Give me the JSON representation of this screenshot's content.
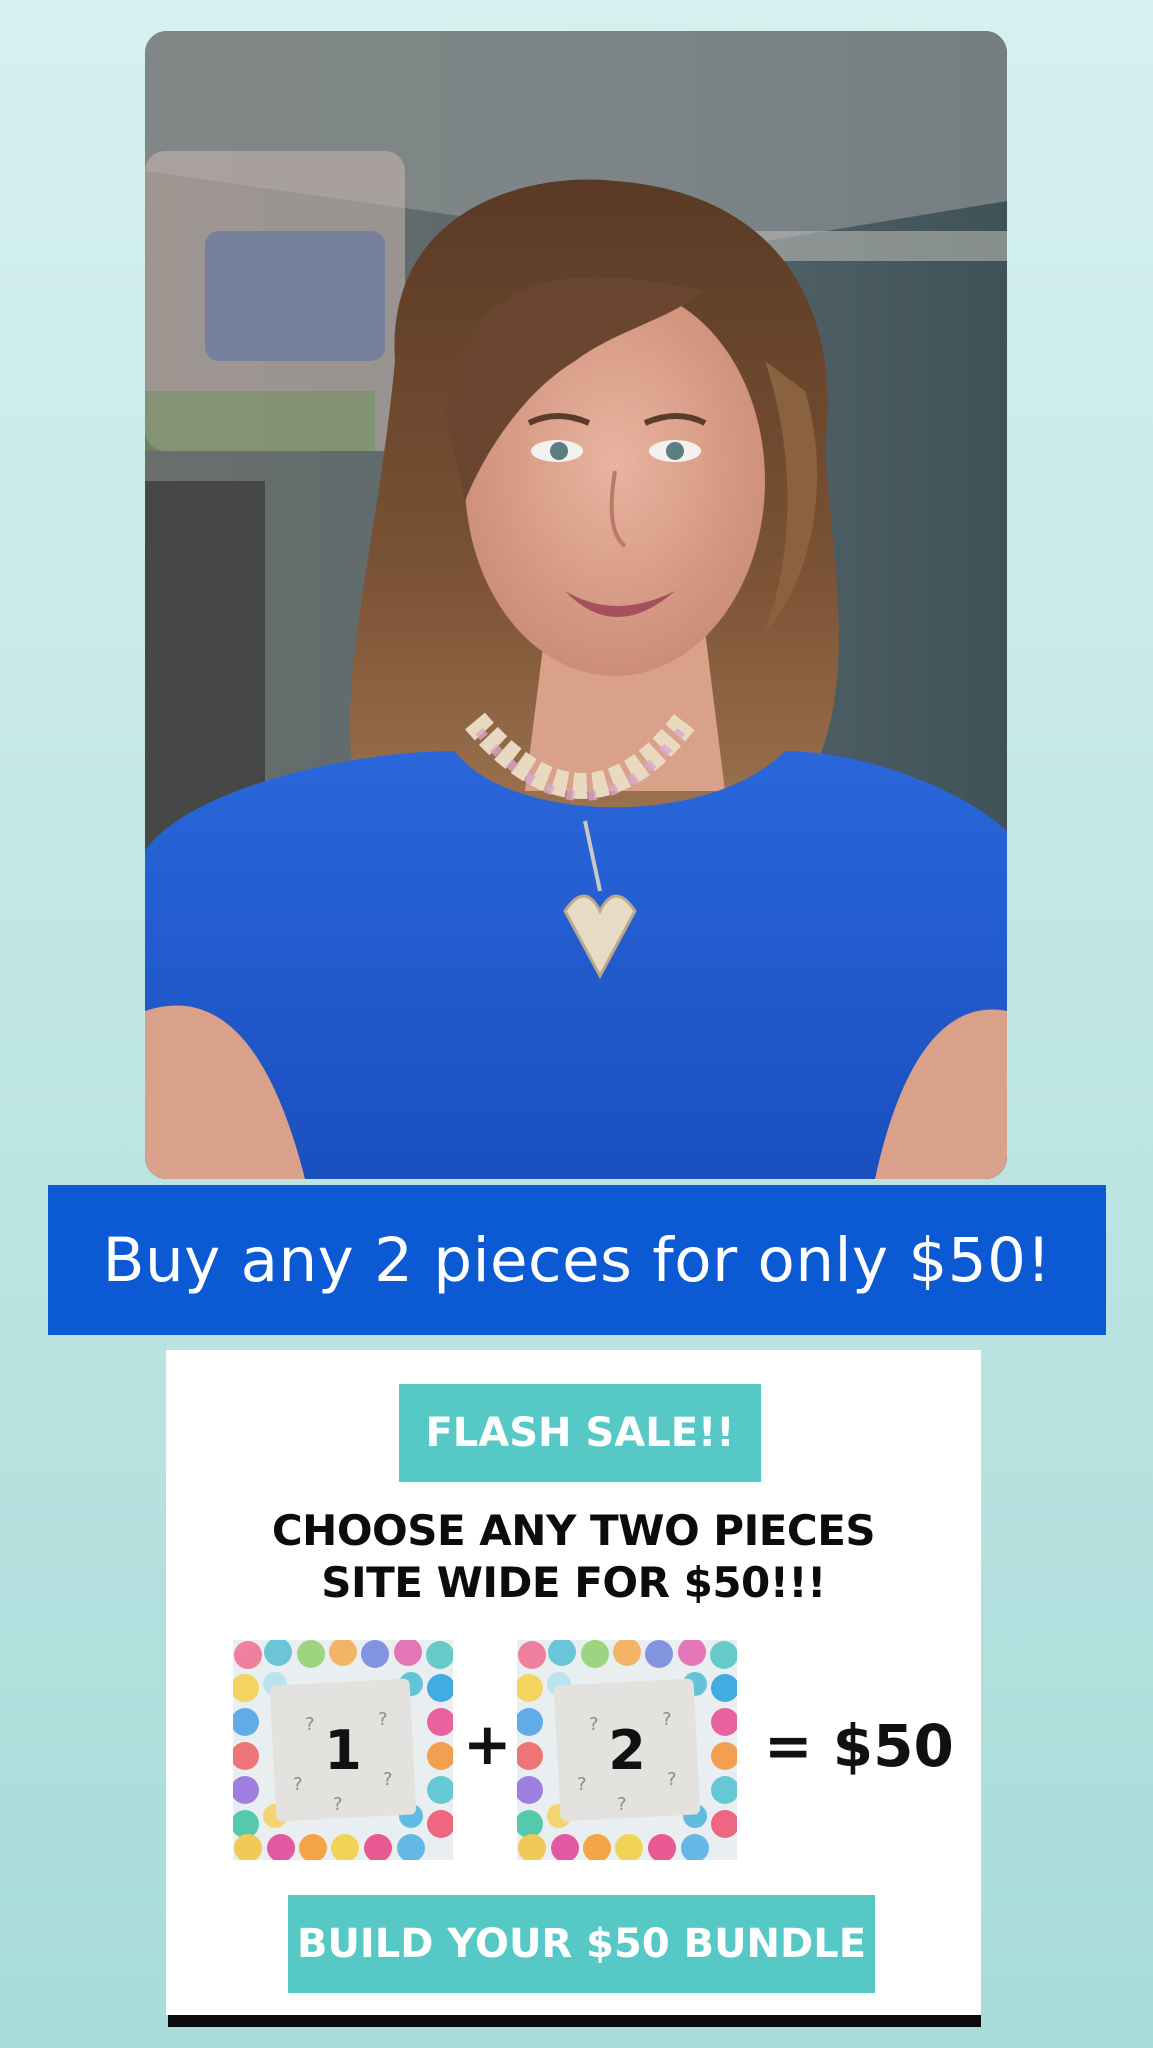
{
  "banner": {
    "text": "Buy any 2 pieces for only $50!",
    "color": "#0b5ad3"
  },
  "promo": {
    "badge": "FLASH SALE!!",
    "headline_line1": "CHOOSE ANY TWO PIECES",
    "headline_line2": "SITE WIDE FOR $50!!!",
    "item1": "1",
    "plus": "+",
    "item2": "2",
    "equals": "= $50",
    "cta": "BUILD YOUR $50 BUNDLE",
    "accent_color": "#56c8c6"
  },
  "photo": {
    "subject": "woman-portrait-icon",
    "shirt_color": "#1f5fd1"
  }
}
